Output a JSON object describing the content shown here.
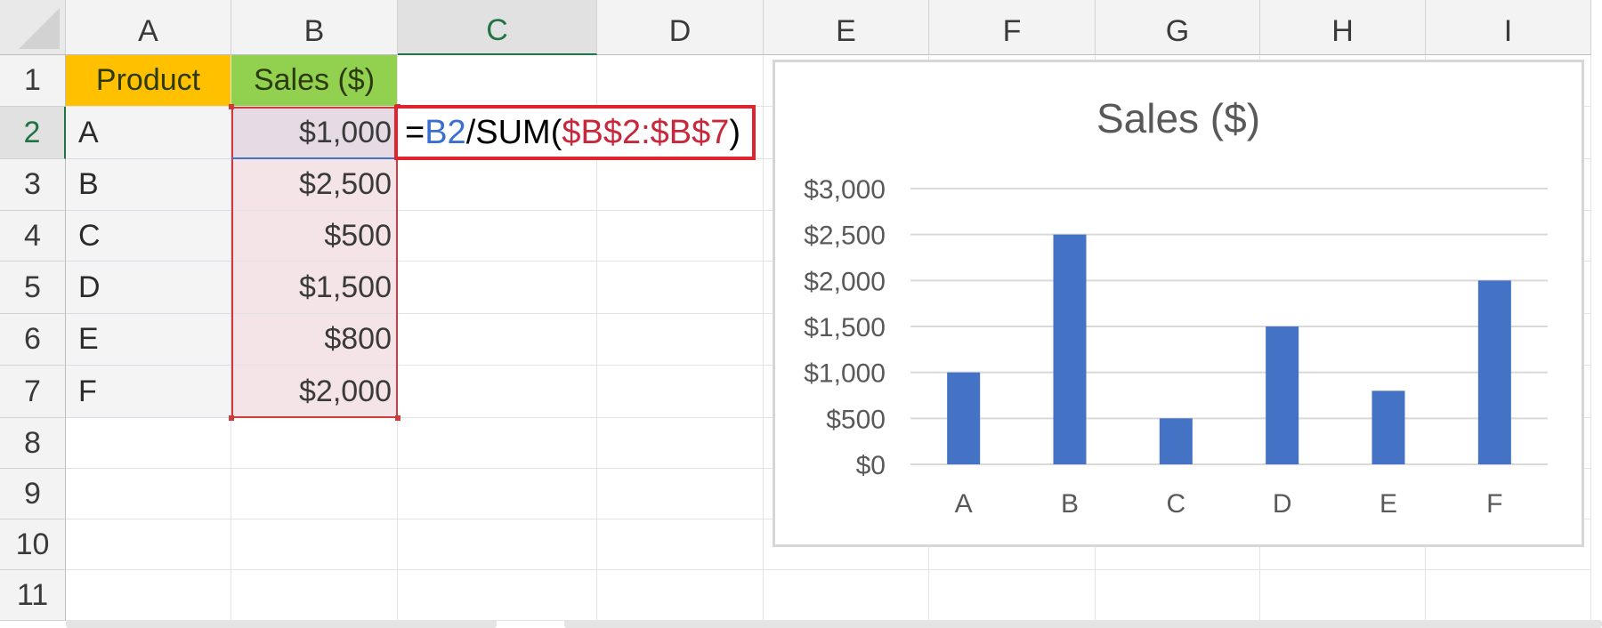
{
  "columns": [
    "A",
    "B",
    "C",
    "D",
    "E",
    "F",
    "G",
    "H",
    "I"
  ],
  "rows": [
    "1",
    "2",
    "3",
    "4",
    "5",
    "6",
    "7",
    "8",
    "9",
    "10",
    "11"
  ],
  "selected_column": "C",
  "selected_row": "2",
  "table": {
    "header_product": "Product",
    "header_sales": "Sales ($)",
    "products": [
      "A",
      "B",
      "C",
      "D",
      "E",
      "F"
    ],
    "sales": [
      "$1,000",
      "$2,500",
      "$500",
      "$1,500",
      "$800",
      "$2,000"
    ]
  },
  "formula": {
    "eq": "=",
    "ref": "B2",
    "mid": "/SUM(",
    "range": "$B$2:$B$7",
    "close": ")"
  },
  "colors": {
    "header_product_fill": "#ffc000",
    "header_sales_fill": "#92d050",
    "bar": "#4472c4",
    "formula_border": "#e0242f",
    "excel_green": "#217346"
  },
  "chart_data": {
    "type": "bar",
    "title": "Sales ($)",
    "categories": [
      "A",
      "B",
      "C",
      "D",
      "E",
      "F"
    ],
    "values": [
      1000,
      2500,
      500,
      1500,
      800,
      2000
    ],
    "ylim": [
      0,
      3000
    ],
    "yticks": [
      "$0",
      "$500",
      "$1,000",
      "$1,500",
      "$2,000",
      "$2,500",
      "$3,000"
    ],
    "ytick_values": [
      0,
      500,
      1000,
      1500,
      2000,
      2500,
      3000
    ],
    "grid": true,
    "legend": "none"
  }
}
